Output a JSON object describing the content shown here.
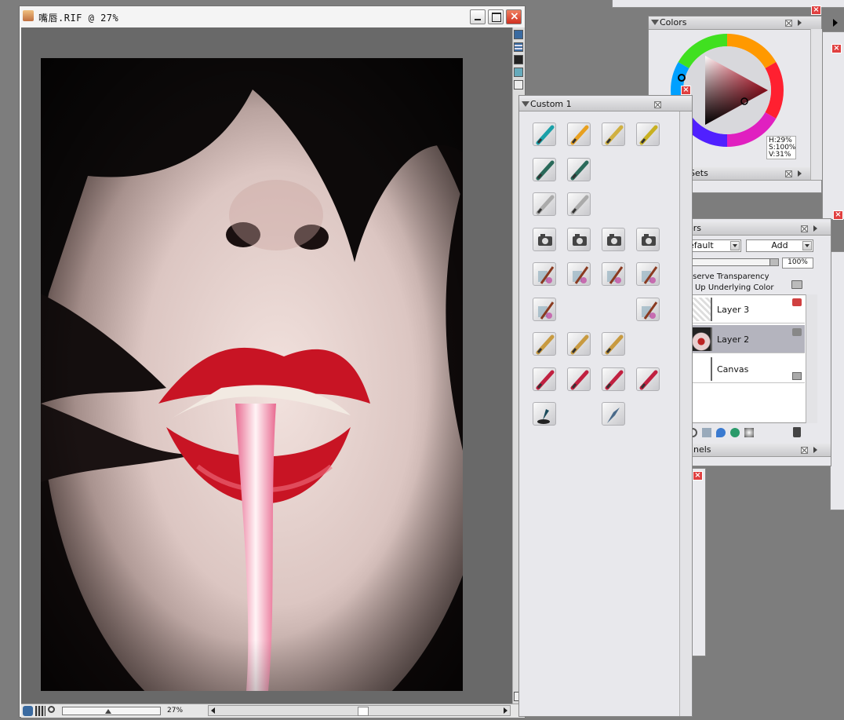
{
  "document": {
    "title": "嘴唇.RIF @ 27%",
    "zoom": "27%"
  },
  "colors_palette": {
    "title": "Colors",
    "readout": {
      "h": "H:29%",
      "s": "S:100%",
      "v": "V:31%"
    },
    "sets_label": "Sets",
    "wheel_hue": "#ff1f3a"
  },
  "custom_palette": {
    "title": "Custom 1",
    "icons": [
      [
        "teal-pencil-icon",
        "orange-pencil-icon",
        "eraser-pencil-icon",
        "green-pencil-icon"
      ],
      [
        "airbrush-icon",
        "airbrush-icon",
        "",
        ""
      ],
      [
        "pen-nib-icon",
        "pen-nib-icon",
        "",
        ""
      ],
      [
        "camera-icon",
        "camera-icon",
        "camera-icon",
        "camera-icon"
      ],
      [
        "watercolor-icon",
        "watercolor-icon",
        "watercolor-icon",
        "watercolor-icon"
      ],
      [
        "watercolor-icon",
        "",
        "",
        "watercolor-icon"
      ],
      [
        "flat-brush-icon",
        "flat-brush-icon",
        "flat-brush-icon",
        ""
      ],
      [
        "paint-brush-icon",
        "paint-brush-icon",
        "paint-brush-icon",
        "paint-brush-icon"
      ],
      [
        "ink-pen-icon",
        "",
        "palette-knife-icon",
        ""
      ]
    ]
  },
  "layers_palette": {
    "title": "ers",
    "composite_method": "efault",
    "composite_depth": "Add",
    "opacity": "100%",
    "preserve_transparency": "eserve Transparency",
    "pick_up_color": "k Up Underlying Color",
    "layers": [
      {
        "name": "Layer 3",
        "selected": false
      },
      {
        "name": "Layer 2",
        "selected": true
      },
      {
        "name": "Canvas",
        "selected": false
      }
    ],
    "channels_title": "nnels"
  },
  "theme": {
    "accent_red": "#e04040",
    "lip_red": "#c81424"
  }
}
